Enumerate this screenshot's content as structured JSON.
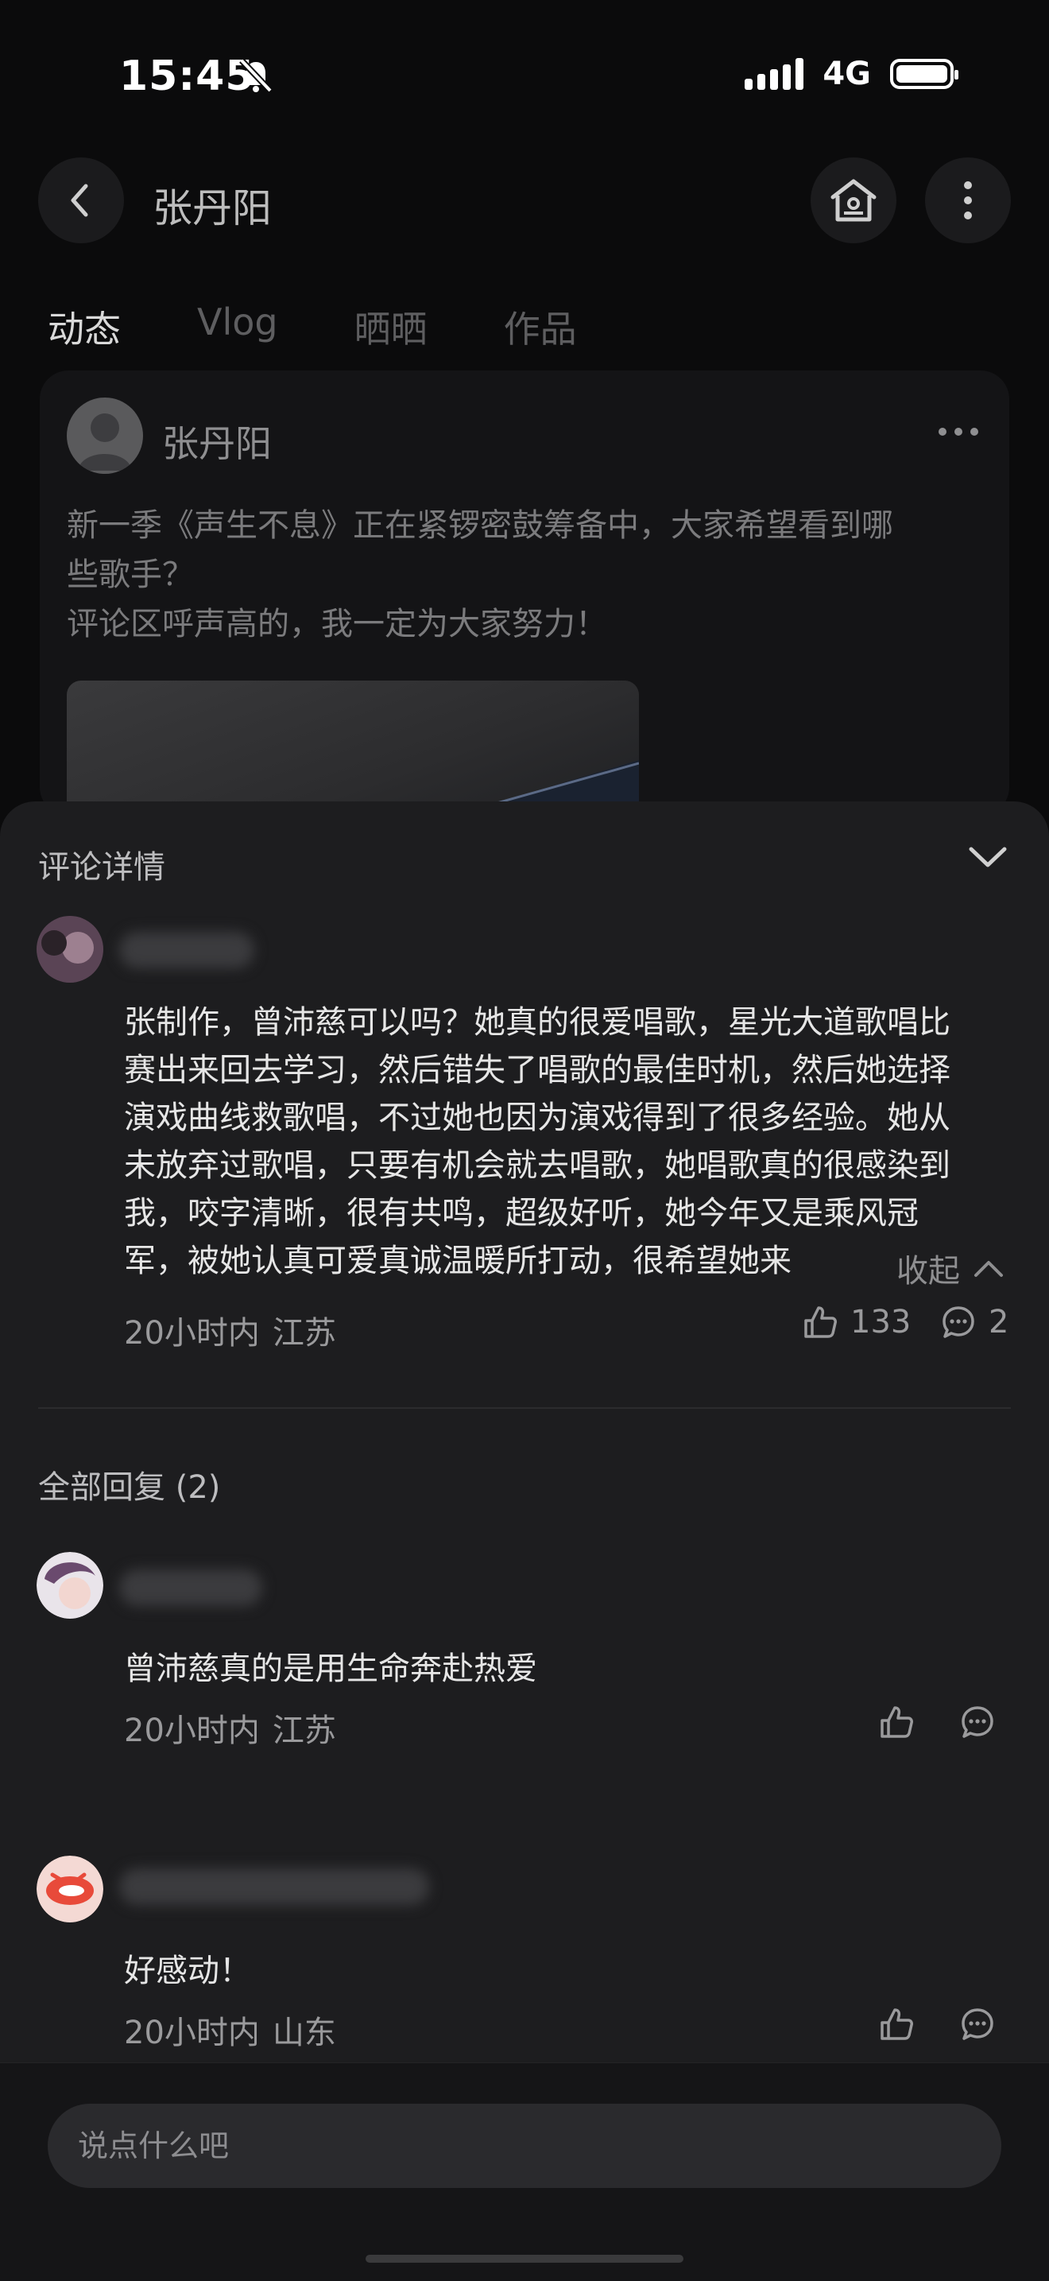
{
  "status_bar": {
    "time": "15:45",
    "network": "4G"
  },
  "header": {
    "title": "张丹阳"
  },
  "tabs": [
    {
      "label": "动态",
      "active": true
    },
    {
      "label": "Vlog"
    },
    {
      "label": "晒晒"
    },
    {
      "label": "作品"
    }
  ],
  "post": {
    "author": "张丹阳",
    "text_lines": [
      "新一季《声生不息》正在紧锣密鼓筹备中，大家希望看到哪",
      "些歌手？",
      "评论区呼声高的，我一定为大家努力！"
    ]
  },
  "comment_sheet": {
    "title": "评论详情",
    "main_comment": {
      "text_lines": [
        "张制作，曾沛慈可以吗？她真的很爱唱歌，星光大道歌唱比",
        "赛出来回去学习，然后错失了唱歌的最佳时机，然后她选择",
        "演戏曲线救歌唱，不过她也因为演戏得到了很多经验。她从",
        "未放弃过歌唱，只要有机会就去唱歌，她唱歌真的很感染到",
        "我，咬字清晰，很有共鸣，超级好听，她今年又是乘风冠",
        "军，被她认真可爱真诚温暖所打动，很希望她来"
      ],
      "collapse_label": "收起",
      "time": "20小时内",
      "location": "江苏",
      "likes": "133",
      "replies": "2"
    },
    "all_replies_label": "全部回复 (2)",
    "replies": [
      {
        "text": "曾沛慈真的是用生命奔赴热爱",
        "time": "20小时内",
        "location": "江苏"
      },
      {
        "text": "好感动！",
        "time": "20小时内",
        "location": "山东"
      }
    ],
    "input_placeholder": "说点什么吧"
  },
  "colors": {
    "accent": "#7c5cff",
    "sheet_bg": "#1d1d1f",
    "page_bg": "#0b0b0c"
  }
}
